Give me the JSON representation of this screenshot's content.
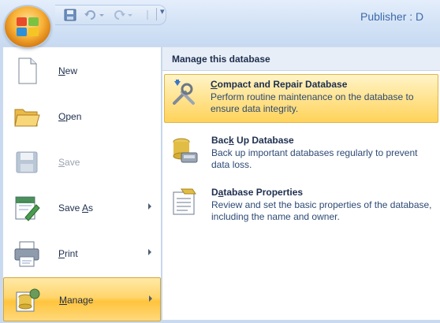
{
  "titlebar": {
    "window_title": "Publisher : D",
    "qat_customize_glyph": "▾"
  },
  "left_menu": {
    "items": [
      {
        "label_pre": "",
        "label_u": "N",
        "label_post": "ew",
        "icon": "new-document-icon",
        "enabled": true,
        "submenu": false
      },
      {
        "label_pre": "",
        "label_u": "O",
        "label_post": "pen",
        "icon": "open-folder-icon",
        "enabled": true,
        "submenu": false
      },
      {
        "label_pre": "",
        "label_u": "S",
        "label_post": "ave",
        "icon": "save-disk-icon",
        "enabled": false,
        "submenu": false
      },
      {
        "label_pre": "Save ",
        "label_u": "A",
        "label_post": "s",
        "icon": "save-as-icon",
        "enabled": true,
        "submenu": true
      },
      {
        "label_pre": "",
        "label_u": "P",
        "label_post": "rint",
        "icon": "printer-icon",
        "enabled": true,
        "submenu": true
      },
      {
        "label_pre": "",
        "label_u": "M",
        "label_post": "anage",
        "icon": "manage-icon",
        "enabled": true,
        "submenu": true,
        "selected": true
      }
    ]
  },
  "right_pane": {
    "header": "Manage this database",
    "commands": [
      {
        "title_pre": "",
        "title_u": "C",
        "title_post": "ompact and Repair Database",
        "description": "Perform routine maintenance on the database to ensure data integrity.",
        "icon": "compact-repair-icon",
        "highlighted": true
      },
      {
        "title_pre": "Bac",
        "title_u": "k",
        "title_post": " Up Database",
        "description": "Back up important databases regularly to prevent data loss.",
        "icon": "backup-database-icon",
        "highlighted": false
      },
      {
        "title_pre": "D",
        "title_u": "a",
        "title_post": "tabase Properties",
        "description": "Review and set the basic properties of the database, including the name and owner.",
        "icon": "database-properties-icon",
        "highlighted": false
      }
    ]
  },
  "colors": {
    "accent_highlight": "#ffd56b",
    "title_text": "#3e6aaa",
    "menu_frame": "#c9daf0"
  }
}
